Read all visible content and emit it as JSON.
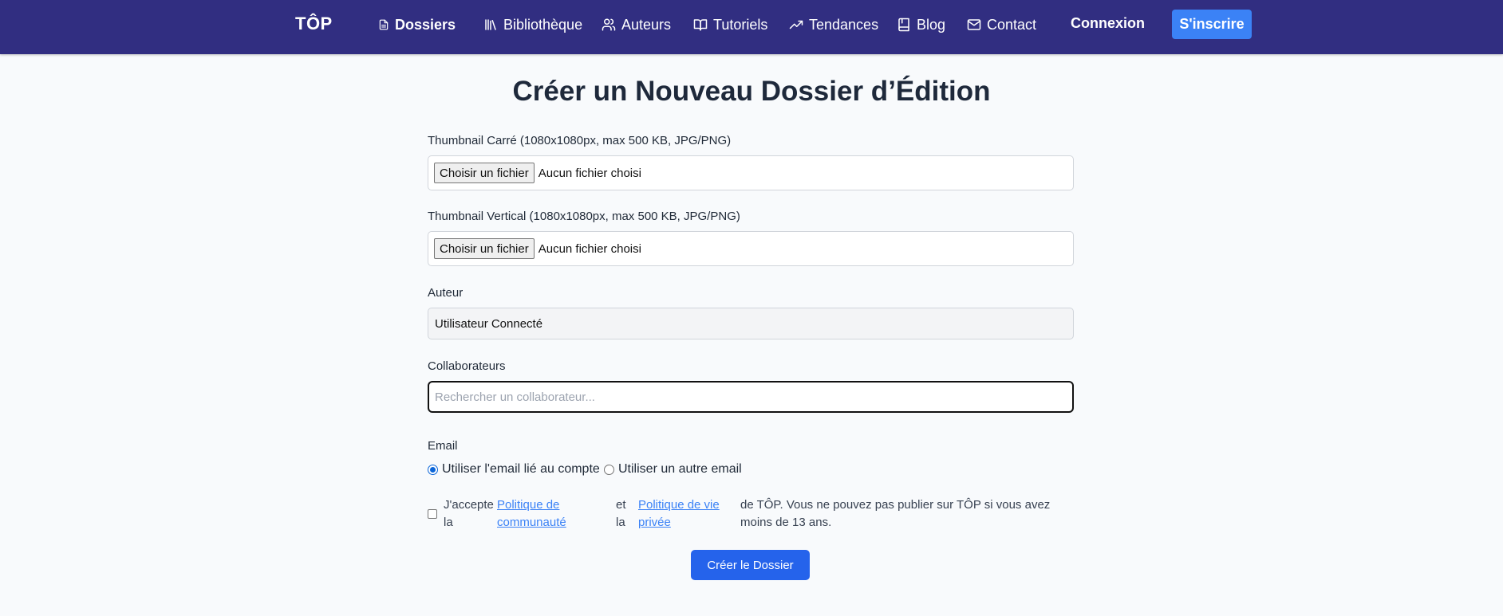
{
  "nav": {
    "brand": "TÔP",
    "items": [
      {
        "label": "Dossiers",
        "icon": "file-icon"
      },
      {
        "label": "Bibliothèque",
        "icon": "library-icon"
      },
      {
        "label": "Auteurs",
        "icon": "users-icon"
      },
      {
        "label": "Tutoriels",
        "icon": "book-open-icon"
      },
      {
        "label": "Tendances",
        "icon": "trending-icon"
      },
      {
        "label": "Blog",
        "icon": "book-icon"
      },
      {
        "label": "Contact",
        "icon": "mail-icon"
      }
    ],
    "login": "Connexion",
    "signup": "S'inscrire"
  },
  "form": {
    "title": "Créer un Nouveau Dossier d’Édition",
    "thumb_square_label": "Thumbnail Carré (1080x1080px, max 500 KB, JPG/PNG)",
    "thumb_vertical_label": "Thumbnail Vertical (1080x1080px, max 500 KB, JPG/PNG)",
    "file_button": "Choisir un fichier",
    "file_status": "Aucun fichier choisi",
    "author_label": "Auteur",
    "author_value": "Utilisateur Connecté",
    "collab_label": "Collaborateurs",
    "collab_placeholder": "Rechercher un collaborateur...",
    "email_label": "Email",
    "email_option_account": "Utiliser l'email lié au compte",
    "email_option_other": "Utiliser un autre email",
    "terms_prefix_1": "J'accepte",
    "terms_prefix_2": "la",
    "terms_link_1_line1": "Politique de",
    "terms_link_1_line2": "communauté",
    "terms_mid_1": "et",
    "terms_mid_2": "la",
    "terms_link_2_line1": "Politique de vie",
    "terms_link_2_line2": "privée",
    "terms_suffix_line1": "de TÔP. Vous ne pouvez pas publier sur TÔP si vous avez",
    "terms_suffix_line2": "moins de 13 ans.",
    "submit": "Créer le Dossier"
  },
  "colors": {
    "navbar": "#312e81",
    "accent": "#3b82f6",
    "submit": "#2563eb"
  }
}
